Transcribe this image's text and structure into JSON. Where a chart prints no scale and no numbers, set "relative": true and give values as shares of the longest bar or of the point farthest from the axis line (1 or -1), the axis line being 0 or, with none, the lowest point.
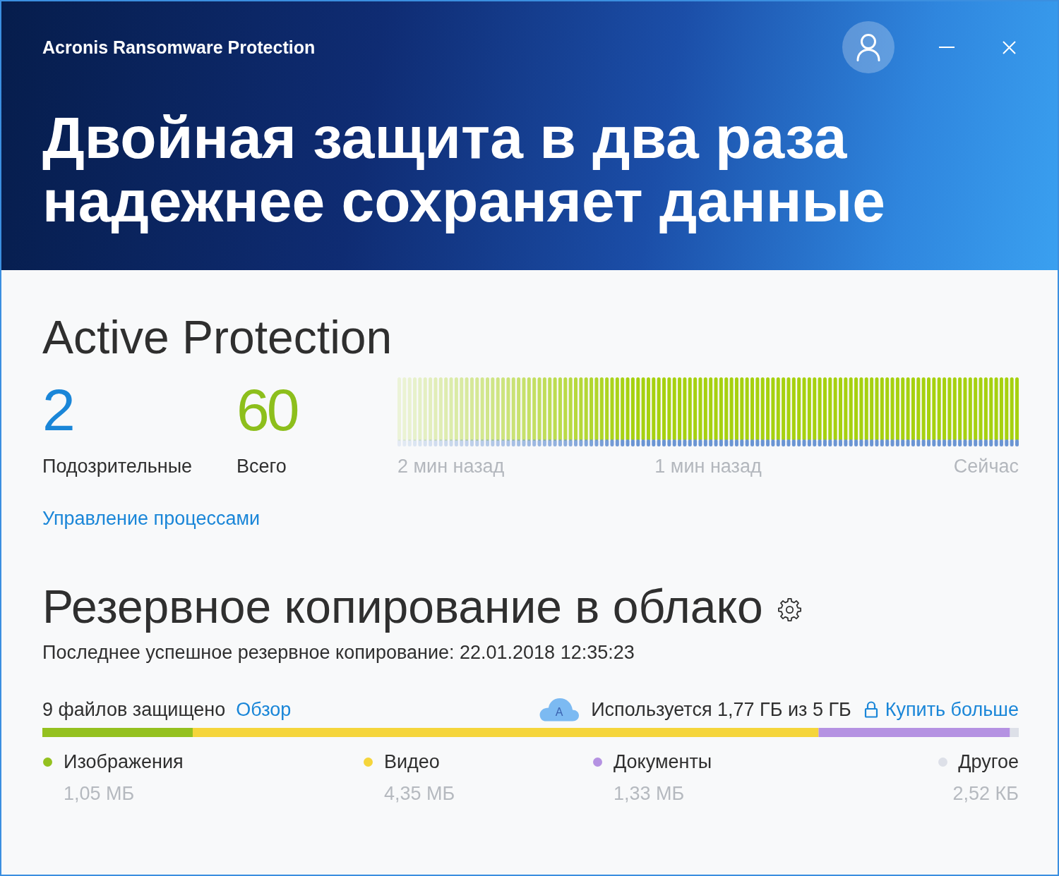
{
  "window": {
    "title": "Acronis Ransomware Protection"
  },
  "banner": {
    "headline": "Двойная защита в два раза надежнее сохраняет данные"
  },
  "active_protection": {
    "title": "Active Protection",
    "stats": [
      {
        "value": "2",
        "label": "Подозрительные",
        "color": "#1a86d8"
      },
      {
        "value": "60",
        "label": "Всего",
        "color": "#8dbf1c"
      }
    ],
    "activity_chart": {
      "time_labels": [
        "2 мин назад",
        "1 мин назад",
        "Сейчас"
      ]
    },
    "link": "Управление процессами"
  },
  "cloud_backup": {
    "title": "Резервное копирование в облако",
    "last_backup": "Последнее успешное резервное копирование: 22.01.2018 12:35:23",
    "files_protected": "9 файлов защищено",
    "browse_link": "Обзор",
    "cloud_badge": "A",
    "usage": "Используется 1,77 ГБ из 5 ГБ",
    "buy_link": "Купить больше",
    "storage_breakdown": {
      "chart_data": {
        "type": "bar",
        "orientation": "horizontal",
        "stacked": true,
        "relative": true,
        "series": [
          {
            "name": "Изображения",
            "color": "#94c11f",
            "values": [
              0.154
            ]
          },
          {
            "name": "Видео",
            "color": "#f5d53b",
            "values": [
              0.641
            ]
          },
          {
            "name": "Документы",
            "color": "#b592e2",
            "values": [
              0.196
            ]
          },
          {
            "name": "Другое",
            "color": "#dde0e8",
            "values": [
              0.009
            ]
          }
        ]
      },
      "legend_sizes": [
        "1,05 МБ",
        "4,35 МБ",
        "1,33 МБ",
        "2,52 КБ"
      ]
    }
  }
}
